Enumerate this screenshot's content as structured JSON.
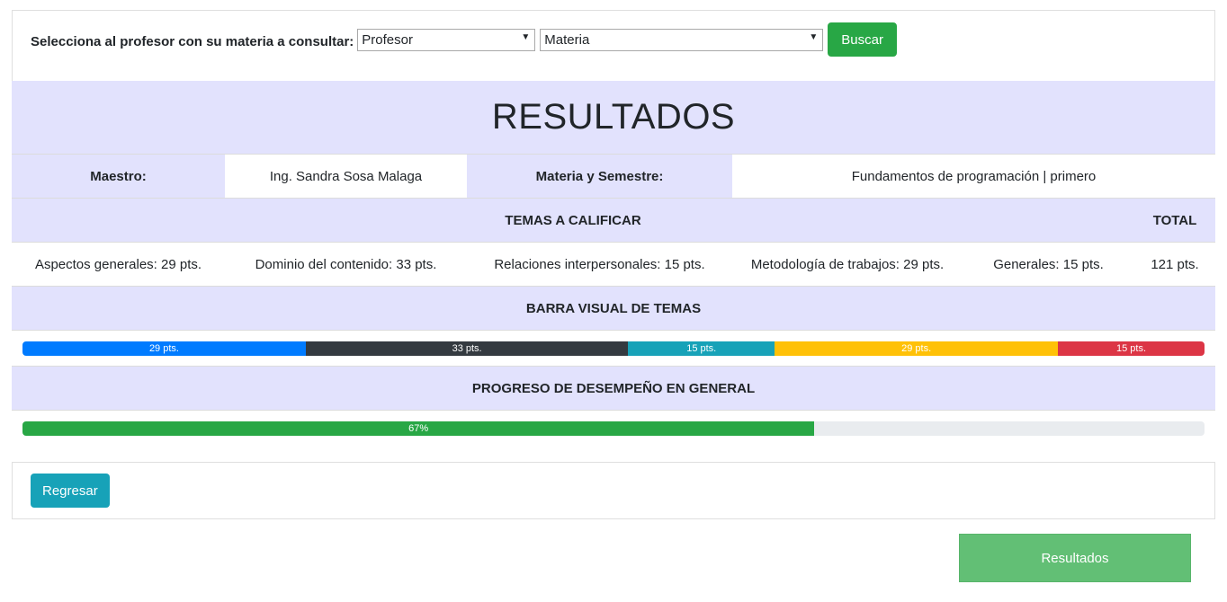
{
  "search": {
    "label": "Selecciona al profesor con su materia a consultar:",
    "profesor_value": "Profesor",
    "materia_value": "Materia",
    "buscar_label": "Buscar"
  },
  "results": {
    "title": "RESULTADOS",
    "maestro_label": "Maestro:",
    "maestro_value": "Ing. Sandra Sosa Malaga",
    "materia_label": "Materia y Semestre:",
    "materia_value": "Fundamentos de programación | primero",
    "temas_header": "TEMAS A CALIFICAR",
    "total_header": "TOTAL",
    "scores": [
      "Aspectos generales: 29 pts.",
      "Dominio del contenido: 33 pts.",
      "Relaciones interpersonales: 15 pts.",
      "Metodología de trabajos: 29 pts.",
      "Generales: 15 pts."
    ],
    "total_value": "121 pts.",
    "barra_header": "BARRA VISUAL DE TEMAS",
    "bar_segments": [
      {
        "label": "29 pts.",
        "value": 29,
        "color": "#007bff"
      },
      {
        "label": "33 pts.",
        "value": 33,
        "color": "#343a40"
      },
      {
        "label": "15 pts.",
        "value": 15,
        "color": "#17a2b8"
      },
      {
        "label": "29 pts.",
        "value": 29,
        "color": "#ffc107"
      },
      {
        "label": "15 pts.",
        "value": 15,
        "color": "#dc3545"
      }
    ],
    "progreso_header": "PROGRESO DE DESEMPEÑO EN GENERAL",
    "progress_label": "67%",
    "progress_percent": 67
  },
  "footer": {
    "regresar_label": "Regresar",
    "resultados_label": "Resultados"
  },
  "colors": {
    "lavender": "#e2e2fd",
    "success": "#28a745",
    "info": "#17a2b8"
  }
}
